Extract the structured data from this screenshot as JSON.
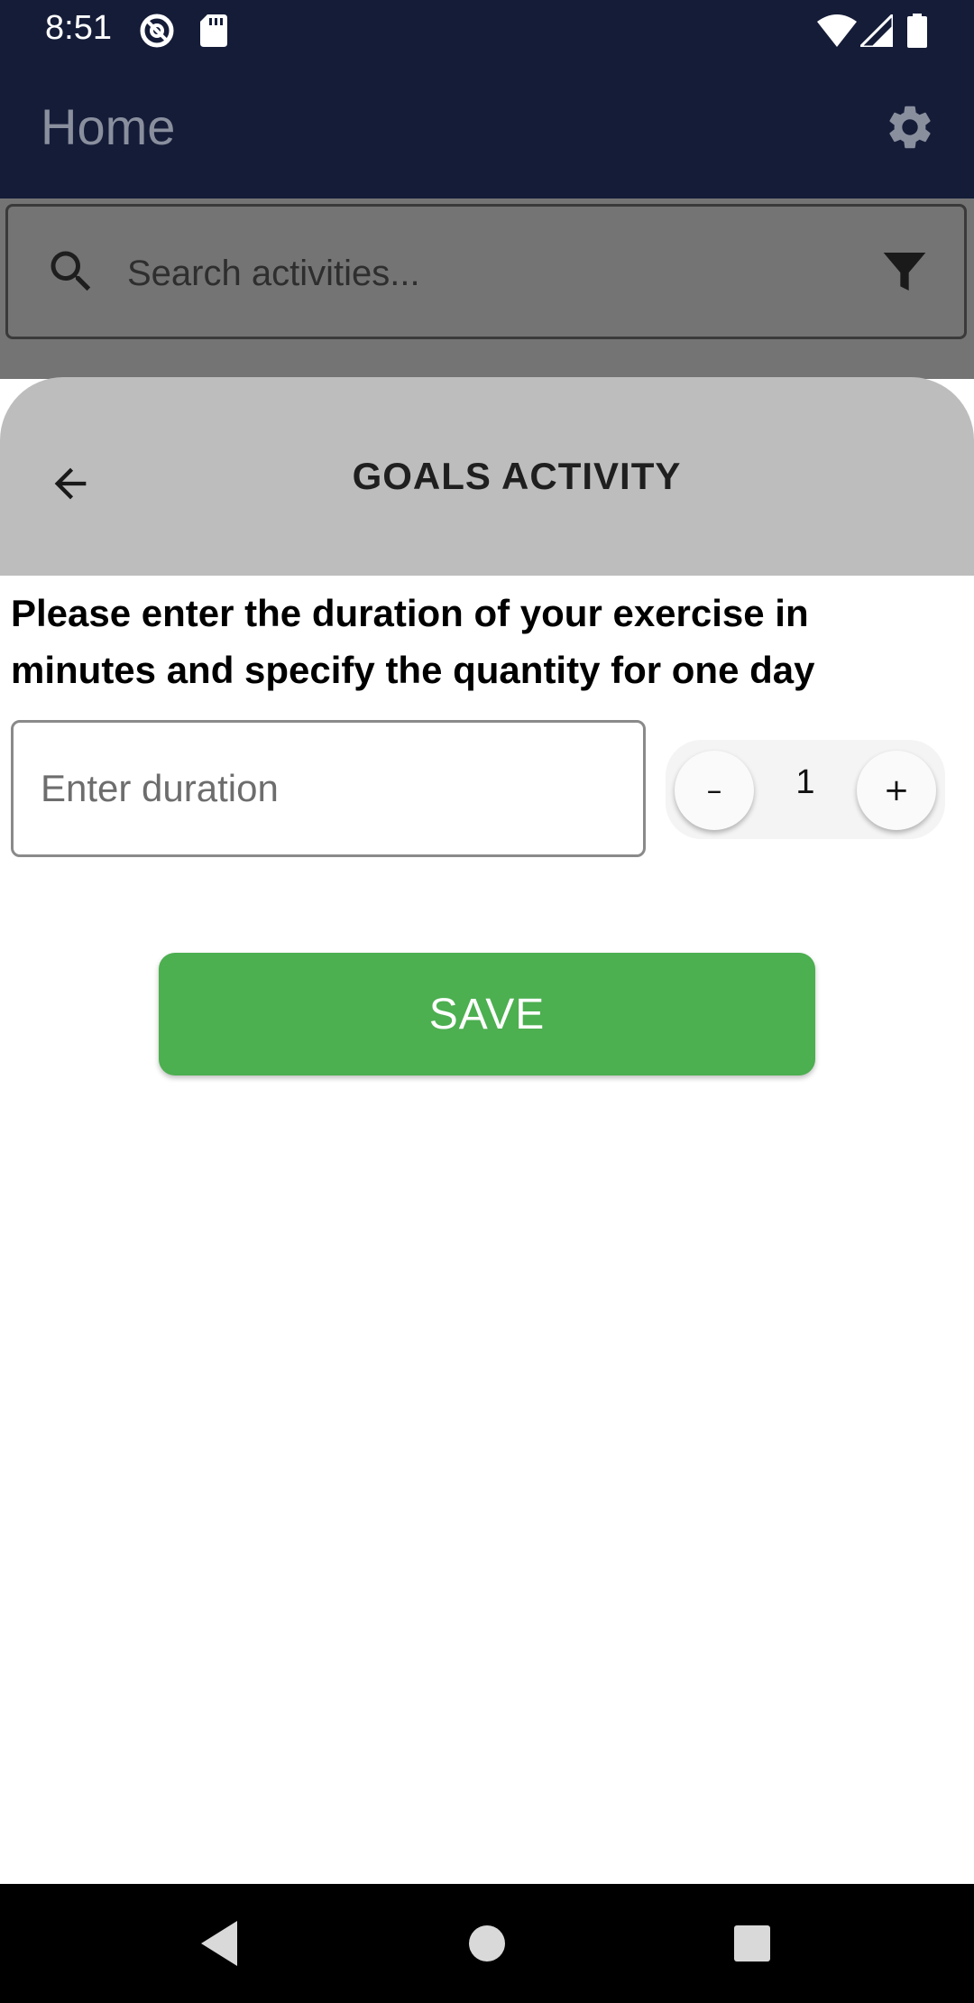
{
  "status_bar": {
    "time": "8:51",
    "left_icons": [
      "at-sign-icon",
      "sd-card-icon"
    ],
    "right_icons": [
      "wifi-icon",
      "signal-icon",
      "battery-icon"
    ]
  },
  "app_bar": {
    "title": "Home",
    "settings_icon": "gear-icon",
    "color": "#141c38"
  },
  "search": {
    "placeholder": "Search activities...",
    "value": "",
    "icon": "search-icon",
    "filter_icon": "filter-icon"
  },
  "sheet": {
    "title": "GOALS ACTIVITY",
    "back_icon": "arrow-left-icon",
    "instructions": "Please enter the duration of your exercise in minutes and specify the quantity for one day",
    "duration_input": {
      "placeholder": "Enter duration",
      "value": ""
    },
    "quantity": {
      "value": "1",
      "decrement_label": "–",
      "increment_label": "+"
    },
    "save_label": "SAVE",
    "save_color": "#4caf50"
  },
  "nav_bar": {
    "icons": [
      "back-triangle-icon",
      "home-circle-icon",
      "recents-square-icon"
    ]
  }
}
